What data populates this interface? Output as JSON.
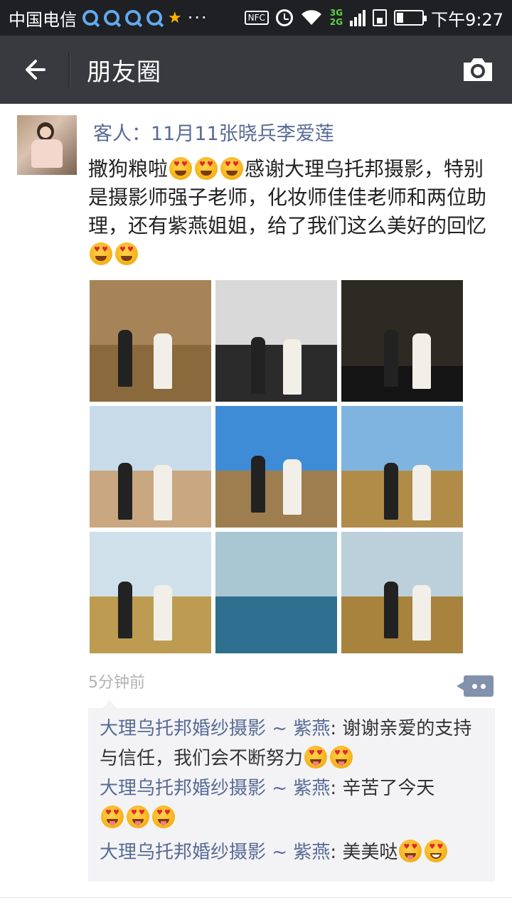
{
  "status_bar": {
    "carrier": "中国电信",
    "nfc": "NFC",
    "network_top": "3G",
    "network_bottom": "2G",
    "battery_level": 0.25,
    "time": "下午9:27",
    "icons": [
      "qq-icon",
      "qq-icon",
      "qq-icon",
      "qq-icon",
      "star-icon",
      "more-dots-icon",
      "nfc-icon",
      "alarm-icon",
      "wifi-icon",
      "signal-icon",
      "sim-icon",
      "battery-icon"
    ]
  },
  "header": {
    "title": "朋友圈",
    "back_icon": "arrow-left-icon",
    "camera_icon": "camera-icon"
  },
  "post": {
    "author": "客人：11月11张晓兵李爱莲",
    "text_parts": [
      "撒狗粮啦",
      "感谢大理乌托邦摄影，特别是摄影师强子老师，化妆师佳佳老师和两位助理，还有紫燕姐姐，给了我们这么美好的回忆"
    ],
    "timestamp": "5分钟前",
    "photos": [
      {
        "name": "photo-1",
        "sky": "#a78358",
        "ground": "#8a6a3c"
      },
      {
        "name": "photo-2",
        "sky": "#d9d9d9",
        "ground": "#2b2b2b"
      },
      {
        "name": "photo-3",
        "sky": "#2c2a22",
        "ground": "#141414"
      },
      {
        "name": "photo-4",
        "sky": "#c8dbe9",
        "ground": "#c9a780"
      },
      {
        "name": "photo-5",
        "sky": "#3f8cd6",
        "ground": "#9e7d4f"
      },
      {
        "name": "photo-6",
        "sky": "#7eb4df",
        "ground": "#b08c48"
      },
      {
        "name": "photo-7",
        "sky": "#cfe0ea",
        "ground": "#bd9c52"
      },
      {
        "name": "photo-8",
        "sky": "#a9c6d3",
        "ground": "#2e6f8f"
      },
      {
        "name": "photo-9",
        "sky": "#bcd0dc",
        "ground": "#a7833d"
      }
    ]
  },
  "comments": [
    {
      "author": "大理乌托邦婚纱摄影 ~ 紫燕",
      "text": ": 谢谢亲爱的支持与信任，我们会不断努力"
    },
    {
      "author": "大理乌托邦婚纱摄影 ~ 紫燕",
      "text": ": 辛苦了今天"
    },
    {
      "author": "大理乌托邦婚纱摄影 ~ 紫燕",
      "text": ": 美美哒"
    }
  ],
  "colors": {
    "link": "#576b95",
    "header_bg": "#393a3f",
    "status_bg": "#1f2023",
    "comment_bg": "#f3f3f5"
  }
}
